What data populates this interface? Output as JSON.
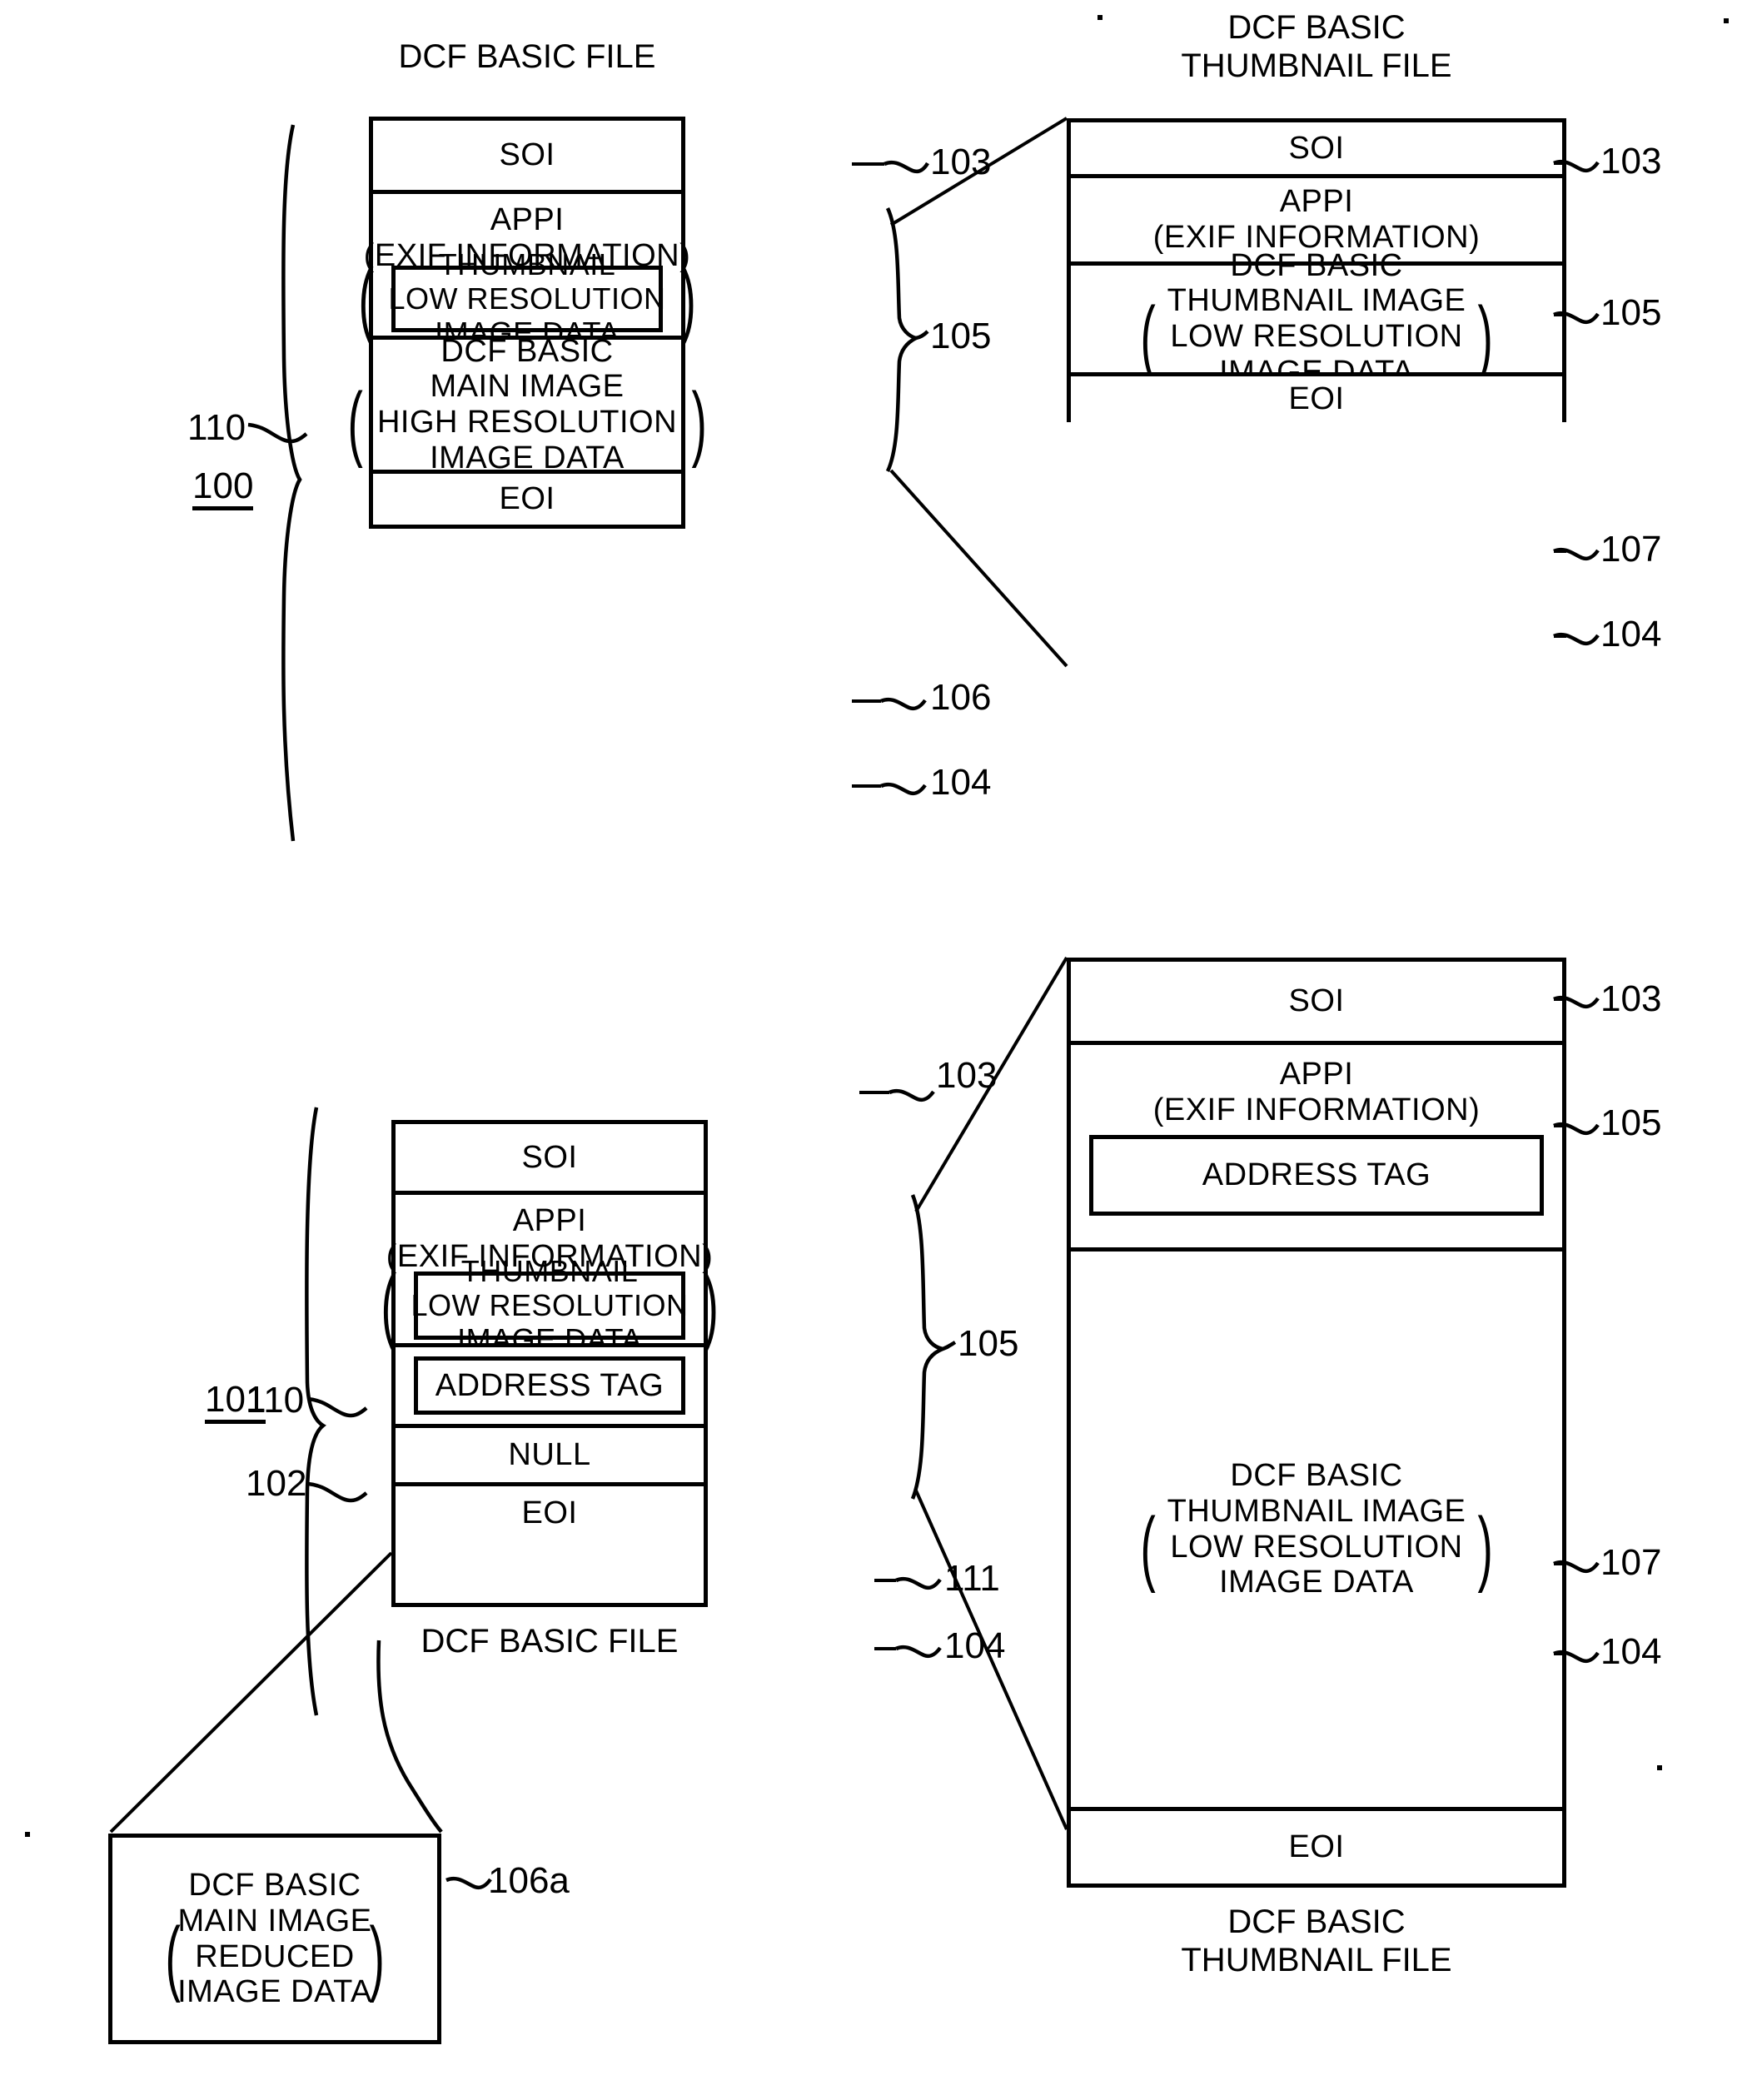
{
  "figure": {
    "type": "patent-diagram",
    "description": "DCF basic file and DCF basic thumbnail file data structures"
  },
  "top_left_file": {
    "title": "DCF BASIC FILE",
    "group_ref": "100",
    "segments": [
      {
        "label": "SOI",
        "ref": "103"
      },
      {
        "label_line1": "APPI",
        "label_line2": "(EXIF INFORMATION)",
        "ref": "105",
        "inner": {
          "line1": "THUMBNAIL",
          "line2": "LOW RESOLUTION",
          "line3": "IMAGE DATA",
          "ref": "110"
        }
      },
      {
        "line1": "DCF BASIC",
        "line2": "MAIN IMAGE",
        "line3": "HIGH RESOLUTION",
        "line4": "IMAGE DATA",
        "ref": "106"
      },
      {
        "label": "EOI",
        "ref": "104"
      }
    ]
  },
  "top_right_file": {
    "title_line1": "DCF BASIC",
    "title_line2": "THUMBNAIL FILE",
    "segments": [
      {
        "label": "SOI",
        "ref": "103"
      },
      {
        "label_line1": "APPI",
        "label_line2": "(EXIF INFORMATION)",
        "ref": "105"
      },
      {
        "line1": "DCF BASIC",
        "line2": "THUMBNAIL IMAGE",
        "line3": "LOW RESOLUTION",
        "line4": "IMAGE DATA",
        "ref": "107"
      },
      {
        "label": "EOI",
        "ref": "104"
      }
    ]
  },
  "bottom_left_file": {
    "caption": "DCF BASIC FILE",
    "group_ref": "101",
    "segments": [
      {
        "label": "SOI",
        "ref": "103"
      },
      {
        "label_line1": "APPI",
        "label_line2": "(EXIF INFORMATION)",
        "ref": "105",
        "inner": {
          "line1": "THUMBNAIL",
          "line2": "LOW RESOLUTION",
          "line3": "IMAGE DATA",
          "ref": "110"
        }
      },
      {
        "inner_label": "ADDRESS TAG",
        "ref": "102"
      },
      {
        "label": "NULL",
        "ref": "111"
      },
      {
        "label": "EOI",
        "ref": "104"
      }
    ]
  },
  "bottom_right_file": {
    "caption_line1": "DCF BASIC",
    "caption_line2": "THUMBNAIL FILE",
    "segments": [
      {
        "label": "SOI",
        "ref": "103"
      },
      {
        "label_line1": "APPI",
        "label_line2": "(EXIF INFORMATION)",
        "ref": "105",
        "inner_label": "ADDRESS TAG"
      },
      {
        "line1": "DCF BASIC",
        "line2": "THUMBNAIL IMAGE",
        "line3": "LOW RESOLUTION",
        "line4": "IMAGE DATA",
        "ref": "107"
      },
      {
        "label": "EOI",
        "ref": "104"
      }
    ]
  },
  "detached_box": {
    "line1": "DCF BASIC",
    "line2": "MAIN IMAGE",
    "line3": "REDUCED",
    "line4": "IMAGE DATA",
    "ref": "106a"
  },
  "colors": {
    "ink": "#000000",
    "paper": "#ffffff"
  }
}
